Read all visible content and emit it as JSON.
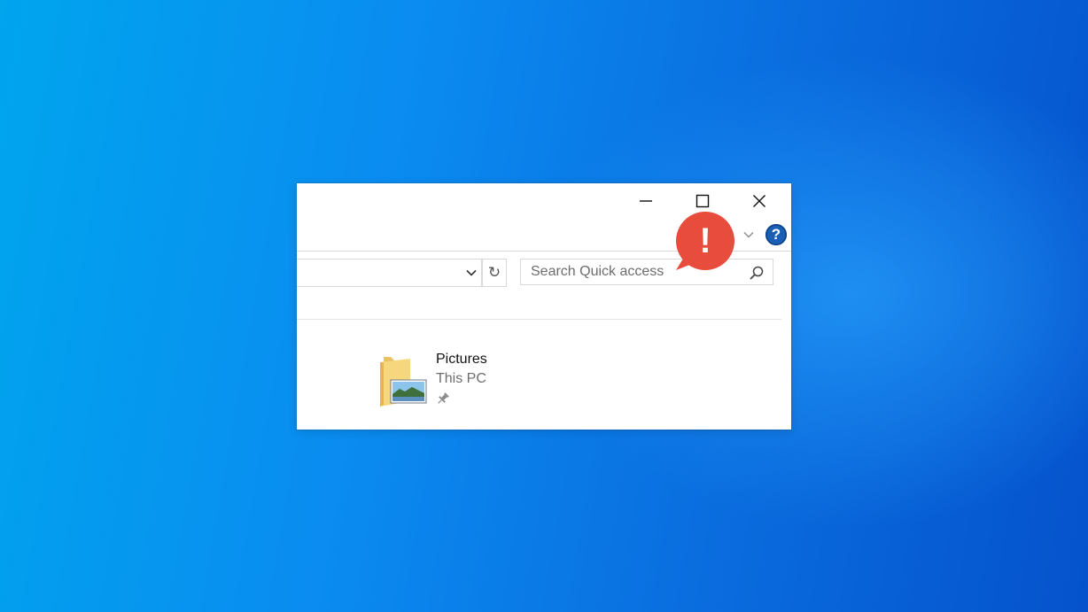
{
  "window": {
    "controls": {
      "minimize_icon": "minimize-icon",
      "maximize_icon": "maximize-icon",
      "close_icon": "close-icon"
    },
    "ribbon": {
      "expand_icon": "chevron-down-icon",
      "help_label": "?"
    }
  },
  "toolbar": {
    "address_value": "",
    "refresh_icon": "↻",
    "search": {
      "placeholder": "Search Quick access",
      "value": ""
    }
  },
  "content": {
    "items": [
      {
        "name": "Pictures",
        "location": "This PC",
        "pinned": true,
        "icon": "pictures-folder-icon"
      }
    ]
  },
  "overlay": {
    "alert_label": "!",
    "alert_color": "#e84c3d"
  },
  "colors": {
    "desktop_start": "#00a5ee",
    "desktop_end": "#0552cc",
    "help_blue": "#1a5fb4"
  }
}
